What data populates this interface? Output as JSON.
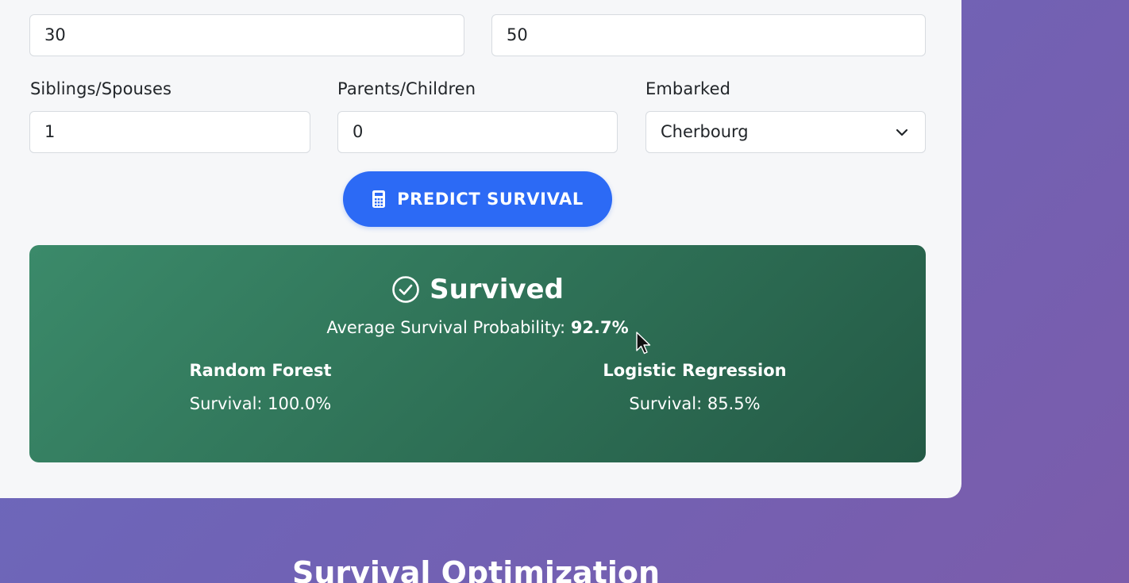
{
  "form": {
    "age_value": "30",
    "fare_value": "50",
    "siblings_label": "Siblings/Spouses",
    "siblings_value": "1",
    "parents_label": "Parents/Children",
    "parents_value": "0",
    "embarked_label": "Embarked",
    "embarked_value": "Cherbourg"
  },
  "predict_button": {
    "label": "PREDICT SURVIVAL",
    "icon": "calculator-icon"
  },
  "result": {
    "status": "Survived",
    "status_icon": "check-circle-icon",
    "avg_label": "Average Survival Probability:",
    "avg_value": "92.7%",
    "models": [
      {
        "name": "Random Forest",
        "survival": "Survival: 100.0%"
      },
      {
        "name": "Logistic Regression",
        "survival": "Survival: 85.5%"
      }
    ]
  },
  "next_section": {
    "title": "Survival Optimization"
  },
  "colors": {
    "primary": "#2c6af5",
    "success": "#2f7257",
    "background": "#6f63b6"
  }
}
